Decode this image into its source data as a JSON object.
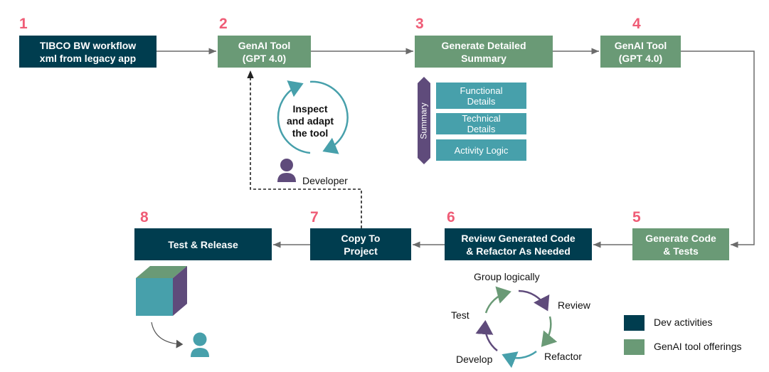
{
  "steps": [
    {
      "number": "1",
      "label": "TIBCO BW workflow\nxml from legacy app",
      "type": "dev"
    },
    {
      "number": "2",
      "label": "GenAI Tool\n(GPT 4.0)",
      "type": "genai"
    },
    {
      "number": "3",
      "label": "Generate Detailed\nSummary",
      "type": "genai"
    },
    {
      "number": "4",
      "label": "GenAI Tool\n(GPT 4.0)",
      "type": "genai"
    },
    {
      "number": "5",
      "label": "Generate Code\n& Tests",
      "type": "genai"
    },
    {
      "number": "6",
      "label": "Review Generated Code\n& Refactor As Needed",
      "type": "dev"
    },
    {
      "number": "7",
      "label": "Copy To\nProject",
      "type": "dev"
    },
    {
      "number": "8",
      "label": "Test & Release",
      "type": "dev"
    }
  ],
  "summary": {
    "side_label": "Summary",
    "items": [
      "Functional\nDetails",
      "Technical\nDetails",
      "Activity Logic"
    ]
  },
  "inspect_cycle": {
    "text_line1": "Inspect",
    "text_line2": "and adapt",
    "text_line3": "the tool",
    "actor": "Developer"
  },
  "dev_cycle": {
    "stages": [
      "Group logically",
      "Review",
      "Refactor",
      "Develop",
      "Test"
    ]
  },
  "legend": [
    {
      "label": "Dev activities",
      "color": "#003d4f"
    },
    {
      "label": "GenAI tool offerings",
      "color": "#6a9a76"
    }
  ],
  "colors": {
    "dev": "#003d4f",
    "genai": "#6a9a76",
    "number": "#ef5c76",
    "teal": "#47a0ab",
    "purple": "#5f4b7b"
  }
}
